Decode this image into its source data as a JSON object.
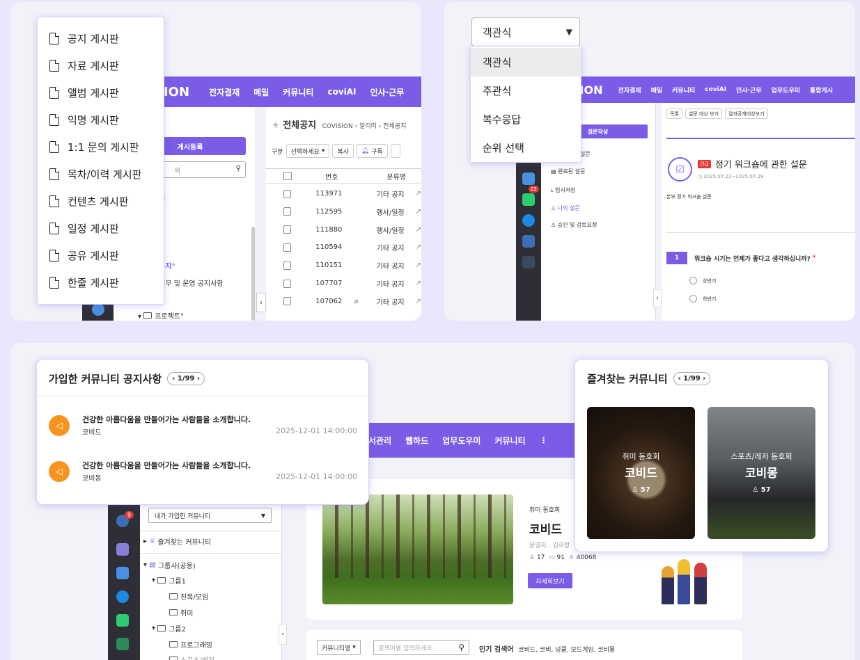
{
  "board_panel": {
    "logo": "SION",
    "nav": [
      "전자결재",
      "메일",
      "커뮤니티",
      "coviAI",
      "인사·근무"
    ],
    "register_btn": "게시등록",
    "search_ph": "색",
    "side_partial": [
      "보기",
      "N°",
      "I°",
      "체공지°",
      "내업무 및 운영 공지사항",
      "고°",
      "프로젝트°"
    ],
    "title": "전체공지",
    "breadcrumb": "COVISION › 알리미 › 전체공지",
    "filter_label": "구분",
    "filter_select": "선택하세요",
    "copy_btn": "복사",
    "subscribe_btn": "구독",
    "col_no": "번호",
    "col_category": "분류명",
    "rows": [
      {
        "no": "113971",
        "cat": "기타 공지"
      },
      {
        "no": "112595",
        "cat": "행사/일정"
      },
      {
        "no": "111880",
        "cat": "행사/일정"
      },
      {
        "no": "110594",
        "cat": "기타 공지"
      },
      {
        "no": "110151",
        "cat": "기타 공지"
      },
      {
        "no": "107707",
        "cat": "기타 공지"
      },
      {
        "no": "107062",
        "cat": "기타 공지"
      }
    ],
    "menu": [
      "공지 게시판",
      "자료 게시판",
      "앨범 게시판",
      "익명 게시판",
      "1:1 문의 게시판",
      "목차/이력 게시판",
      "컨텐츠 게시판",
      "일정 게시판",
      "공유 게시판",
      "한줄 게시판"
    ]
  },
  "survey_panel": {
    "logo": "SION",
    "nav": [
      "전자결재",
      "메일",
      "커뮤니티",
      "coviAI",
      "인사·근무",
      "업무도우미",
      "통합게시"
    ],
    "dropdown_value": "객관식",
    "dropdown_options": [
      "객관식",
      "주관식",
      "복수응답",
      "순위 선택"
    ],
    "write_btn": "설문작성",
    "side_items": [
      "설문",
      "완료된 설문",
      "임시저장",
      "나의 설문",
      "승인 및 검토요청"
    ],
    "badge": "22",
    "tabs": [
      "목록",
      "설문 대상 보기",
      "결과공개대상보기"
    ],
    "urgent": "긴급",
    "survey_title": "정기 워크숍에 관한 설문",
    "period": "2025.07.22~2025.07.29",
    "desc": "본부 정기 워크숍 설문",
    "q_no": "1",
    "question": "워크숍 시기는 언제가 좋다고 생각하십니까?",
    "required": "*",
    "options": [
      "상반기",
      "하반기"
    ]
  },
  "community_panel": {
    "nav": [
      "서관리",
      "웹하드",
      "업무도우미",
      "커뮤니티",
      "⋮"
    ],
    "my_select": "내가 가입한 커뮤니티",
    "badge": "9",
    "tree": [
      "즐겨찾는 커뮤니티",
      "그룹사(공용)",
      "그룹1",
      "친목/모임",
      "취미",
      "그룹2",
      "프로그래밍",
      "스포츠/레저"
    ],
    "notice_title": "가입한 커뮤니티 공지사항",
    "notice_pager": "1/99",
    "notices": [
      {
        "title": "건강한 아름다움을 만들어가는 사람들을 소개합니다.",
        "community": "코비드",
        "date": "2025-12-01 14:00:00"
      },
      {
        "title": "건강한 아름다움을 만들어가는 사람들을 소개합니다.",
        "community": "코비몽",
        "date": "2025-12-01 14:00:00"
      }
    ],
    "fav_title": "즐겨찾는 커뮤니티",
    "fav_pager": "1/99",
    "favs": [
      {
        "category": "취미 동호회",
        "name": "코비드",
        "members": "57"
      },
      {
        "category": "스포츠/레저 동호회",
        "name": "코비몽",
        "members": "57"
      }
    ],
    "feature_category": "취미 동호회",
    "feature_name": "코비드",
    "operator": "운영자 : 김하랑",
    "stat_members": "17",
    "stat_posts": "91",
    "stat_visits": "40068",
    "detail_btn": "자세히보기",
    "search_select": "커뮤니티명",
    "search_ph": "검색어를 입력하세요.",
    "popular_label": "인기 검색어",
    "popular_terms": "코비드, 코비, 넝쿨, 보드게임, 코비몽"
  }
}
